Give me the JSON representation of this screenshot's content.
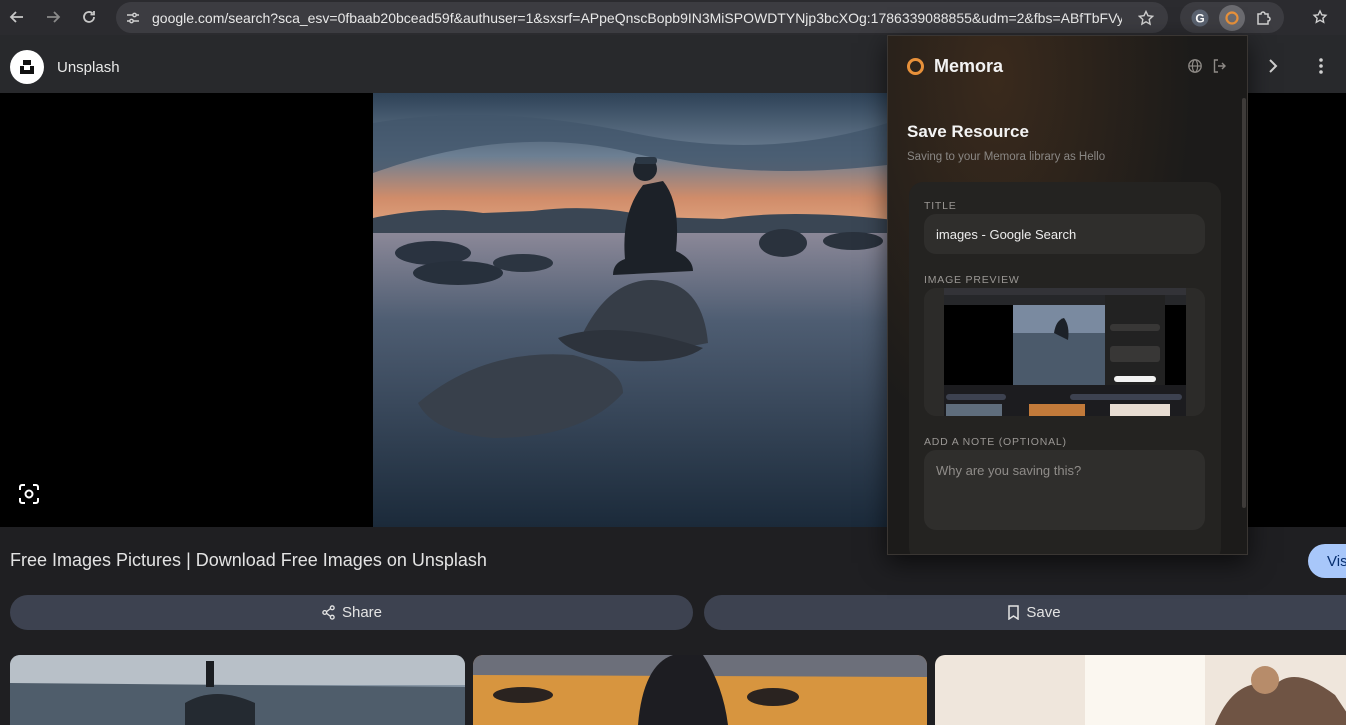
{
  "browser": {
    "url": "google.com/search?sca_esv=0fbaab20bcead59f&authuser=1&sxsrf=APpeQnscBopb9IN3MiSPOWDTYNjp3bcXOg:1786339088855&udm=2&fbs=ABfTbFVy..."
  },
  "viewer": {
    "site_name": "Unsplash",
    "result_title": "Free Images Pictures | Download Free Images on Unsplash",
    "visit_label": "Vis",
    "share_label": "Share",
    "save_label": "Save"
  },
  "memora": {
    "brand": "Memora",
    "heading": "Save Resource",
    "subtitle": "Saving to your Memora library as Hello",
    "title_label": "TITLE",
    "title_value": "images - Google Search",
    "preview_label": "IMAGE PREVIEW",
    "note_label": "ADD A NOTE (OPTIONAL)",
    "note_placeholder": "Why are you saving this?",
    "accent": "#e8913a"
  },
  "colors": {
    "chrome": "#2b2b2f",
    "omnibox": "#3c3c41",
    "action_button": "#3d4250",
    "visit_button": "#a8c7fa"
  },
  "icons": {
    "back": "arrow-left-icon",
    "forward": "arrow-right-icon",
    "reload": "reload-icon",
    "site_info": "tune-icon",
    "bookmark": "star-icon",
    "lens": "lens-icon",
    "share": "share-icon",
    "save": "bookmark-icon"
  }
}
